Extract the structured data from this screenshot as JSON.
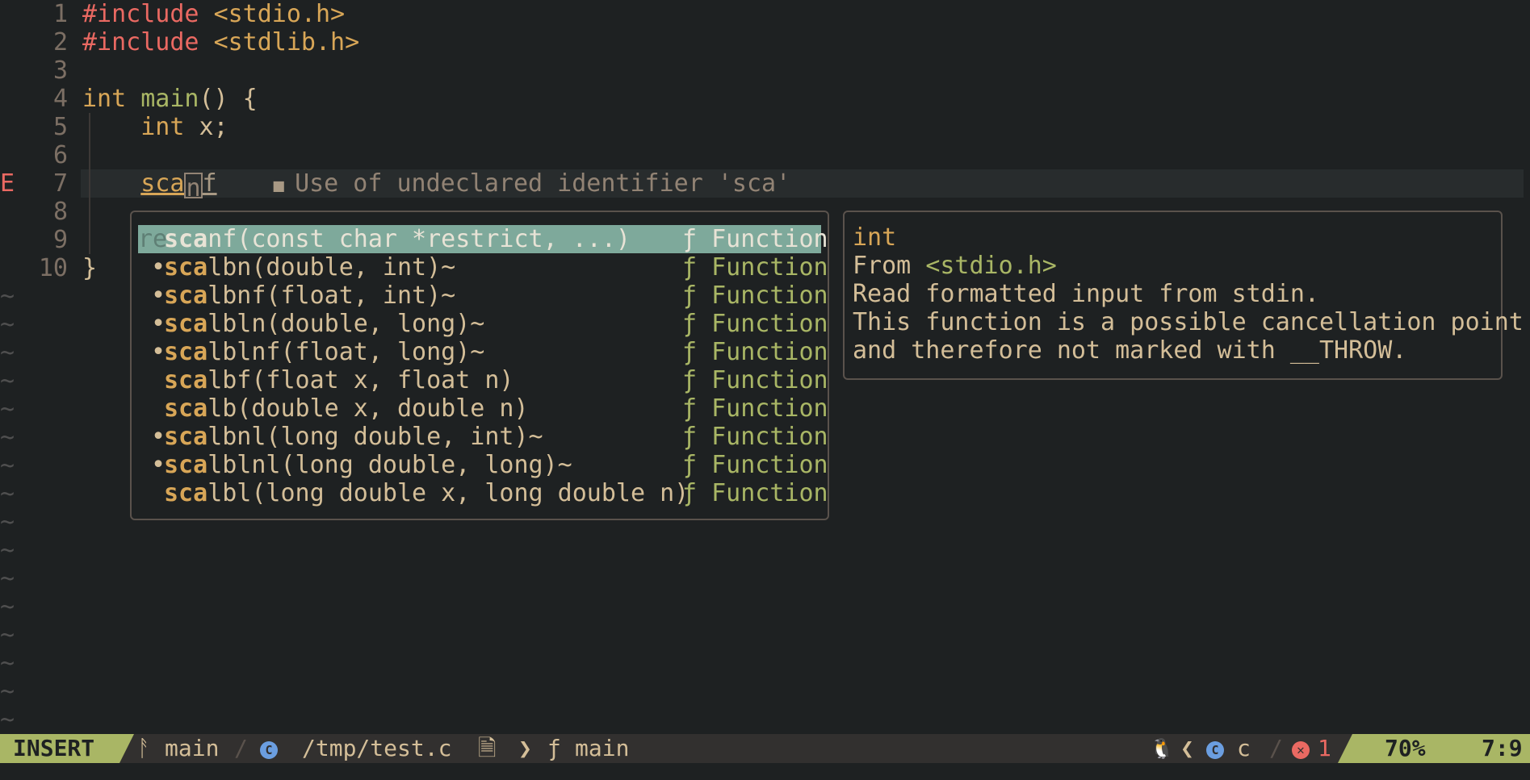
{
  "editor": {
    "lines": [
      {
        "num": "1",
        "parts": [
          [
            "kw-inc",
            "#include "
          ],
          [
            "hdr",
            "<stdio.h>"
          ]
        ]
      },
      {
        "num": "2",
        "parts": [
          [
            "kw-inc",
            "#include "
          ],
          [
            "hdr",
            "<stdlib.h>"
          ]
        ]
      },
      {
        "num": "3",
        "parts": []
      },
      {
        "num": "4",
        "parts": [
          [
            "type",
            "int "
          ],
          [
            "func",
            "main"
          ],
          [
            "plain",
            "() {"
          ]
        ]
      },
      {
        "num": "5",
        "parts": [
          [
            "plain",
            "    "
          ],
          [
            "type",
            "int "
          ],
          [
            "plain",
            "x;"
          ]
        ]
      },
      {
        "num": "6",
        "parts": []
      },
      {
        "num": "7",
        "parts": []
      },
      {
        "num": "8",
        "parts": []
      },
      {
        "num": "9",
        "parts": []
      },
      {
        "num": "10",
        "parts": [
          [
            "plain",
            "}"
          ]
        ]
      }
    ],
    "error_sign": "E",
    "current_line": {
      "typed": "sca",
      "cursor_char": "n",
      "after_cursor": "f",
      "diagnostic_square": "■",
      "diagnostic": "Use of undeclared identifier 'sca'"
    },
    "ghost_text": "re",
    "tilde": "~",
    "tilde_count": 16
  },
  "completion": {
    "match": "sca",
    "kind_icon": "ƒ",
    "items": [
      {
        "dot": "",
        "rest": "nf(const char *restrict, ...)",
        "kind": "Function",
        "selected": true
      },
      {
        "dot": "•",
        "rest": "lbn(double, int)~",
        "kind": "Function",
        "selected": false
      },
      {
        "dot": "•",
        "rest": "lbnf(float, int)~",
        "kind": "Function",
        "selected": false
      },
      {
        "dot": "•",
        "rest": "lbln(double, long)~",
        "kind": "Function",
        "selected": false
      },
      {
        "dot": "•",
        "rest": "lblnf(float, long)~",
        "kind": "Function",
        "selected": false
      },
      {
        "dot": "",
        "rest": "lbf(float x, float n)",
        "kind": "Function",
        "selected": false
      },
      {
        "dot": "",
        "rest": "lb(double x, double n)",
        "kind": "Function",
        "selected": false
      },
      {
        "dot": "•",
        "rest": "lbnl(long double, int)~",
        "kind": "Function",
        "selected": false
      },
      {
        "dot": "•",
        "rest": "lblnl(long double, long)~",
        "kind": "Function",
        "selected": false
      },
      {
        "dot": "",
        "rest": "lbl(long double x, long double n)",
        "kind": "Function",
        "selected": false
      }
    ]
  },
  "doc": {
    "return_type": "int",
    "from_label": "From ",
    "from_header": "<stdio.h>",
    "line1": "Read formatted input from stdin.",
    "line2": "This function is a possible cancellation point",
    "line3": "and therefore not marked with __THROW."
  },
  "statusline": {
    "mode": "INSERT",
    "branch_icon": "ᚨ",
    "branch": "main",
    "file_icon_letter": "C",
    "file_path": "/tmp/test.c",
    "breadcrumb_file_icon": "🗎",
    "breadcrumb_sep": "❯",
    "symbol_icon": "ƒ",
    "symbol": "main",
    "os_icon": "🐧",
    "ft_sep": "❮",
    "filetype": "c",
    "error_icon": "✕",
    "error_count": "1",
    "percent": "70%",
    "position": "7:9"
  },
  "colors": {
    "background": "#1e2122",
    "selection": "#7ea99b",
    "mode_accent": "#a9b665",
    "error": "#ea6962"
  }
}
